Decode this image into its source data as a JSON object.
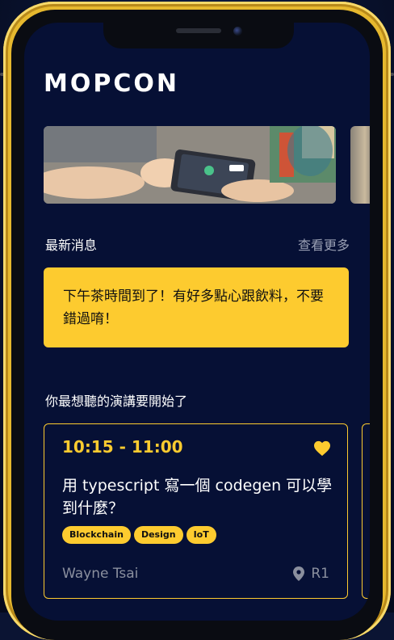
{
  "app": {
    "logo": "MOPCON"
  },
  "banner": {
    "image": "photo-of-phones-being-shown"
  },
  "news": {
    "title": "最新消息",
    "see_more": "查看更多",
    "items": [
      {
        "text": "下午茶時間到了！有好多點心跟飲料，不要錯過唷！"
      }
    ]
  },
  "sessions": {
    "title": "你最想聽的演講要開始了",
    "cards": [
      {
        "time": "10:15 - 11:00",
        "title": "用 typescript 寫一個 codegen 可以學到什麼？",
        "tags": [
          "Blockchain",
          "Design",
          "IoT"
        ],
        "speaker": "Wayne Tsai",
        "room": "R1",
        "favorited": true
      }
    ]
  },
  "colors": {
    "accent": "#fdcb2f",
    "background": "#061035",
    "muted_text": "#8a8f9e",
    "phone_frame": "#e6b82e"
  },
  "icons": [
    "heart-icon",
    "location-pin-icon"
  ]
}
